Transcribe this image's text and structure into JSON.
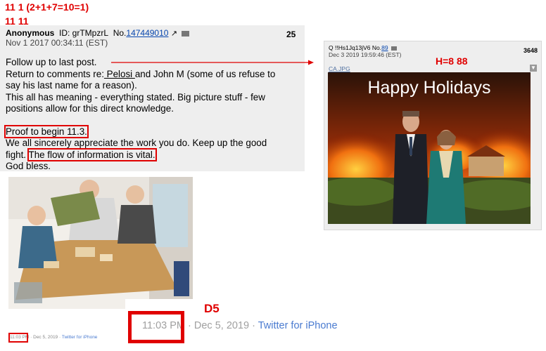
{
  "annotations": {
    "line1": "11 1 (2+1+7=10=1)",
    "line2": "11 11",
    "h_label": "H=8  88",
    "d5_label": "D5"
  },
  "post1": {
    "name": "Anonymous",
    "id_text": "ID: grTMpzrL",
    "no_label": "No.",
    "number": "147449010",
    "date": "Nov 1 2017 00:34:11 (EST)",
    "reply_count": "25",
    "lines": {
      "l1": "Follow up to last post.",
      "l2a": "Return to comments re:",
      "l2b": " Pelosi ",
      "l2c": "and John M (some of us refuse to",
      "l3": "say his last name for a reason).",
      "l4": "This all has meaning - everything stated. Big picture stuff - few",
      "l5": "positions allow for this direct knowledge.",
      "l6": "Proof to begin 11.3.",
      "l7": "We all sincerely appreciate the work you do. Keep up the good",
      "l8a": "fight.",
      "l8b": "The flow of information is vital.",
      "l9": "God bless."
    }
  },
  "post2": {
    "header": "Q !!Hs1Jq13jV6 No.",
    "number": "89",
    "date": "Dec 3 2019 19:59:46 (EST)",
    "reply_count": "3648",
    "filename": "CA.JPG",
    "image_title": "Happy Holidays"
  },
  "tweet_small": {
    "time": "11:03 PM",
    "sep": " · Dec 5, 2019 · ",
    "source": "Twitter for iPhone"
  },
  "tweet_zoom": {
    "time": "11:03 PM",
    "sep": " · Dec 5, 2019 · ",
    "source": "Twitter for iPhone"
  }
}
